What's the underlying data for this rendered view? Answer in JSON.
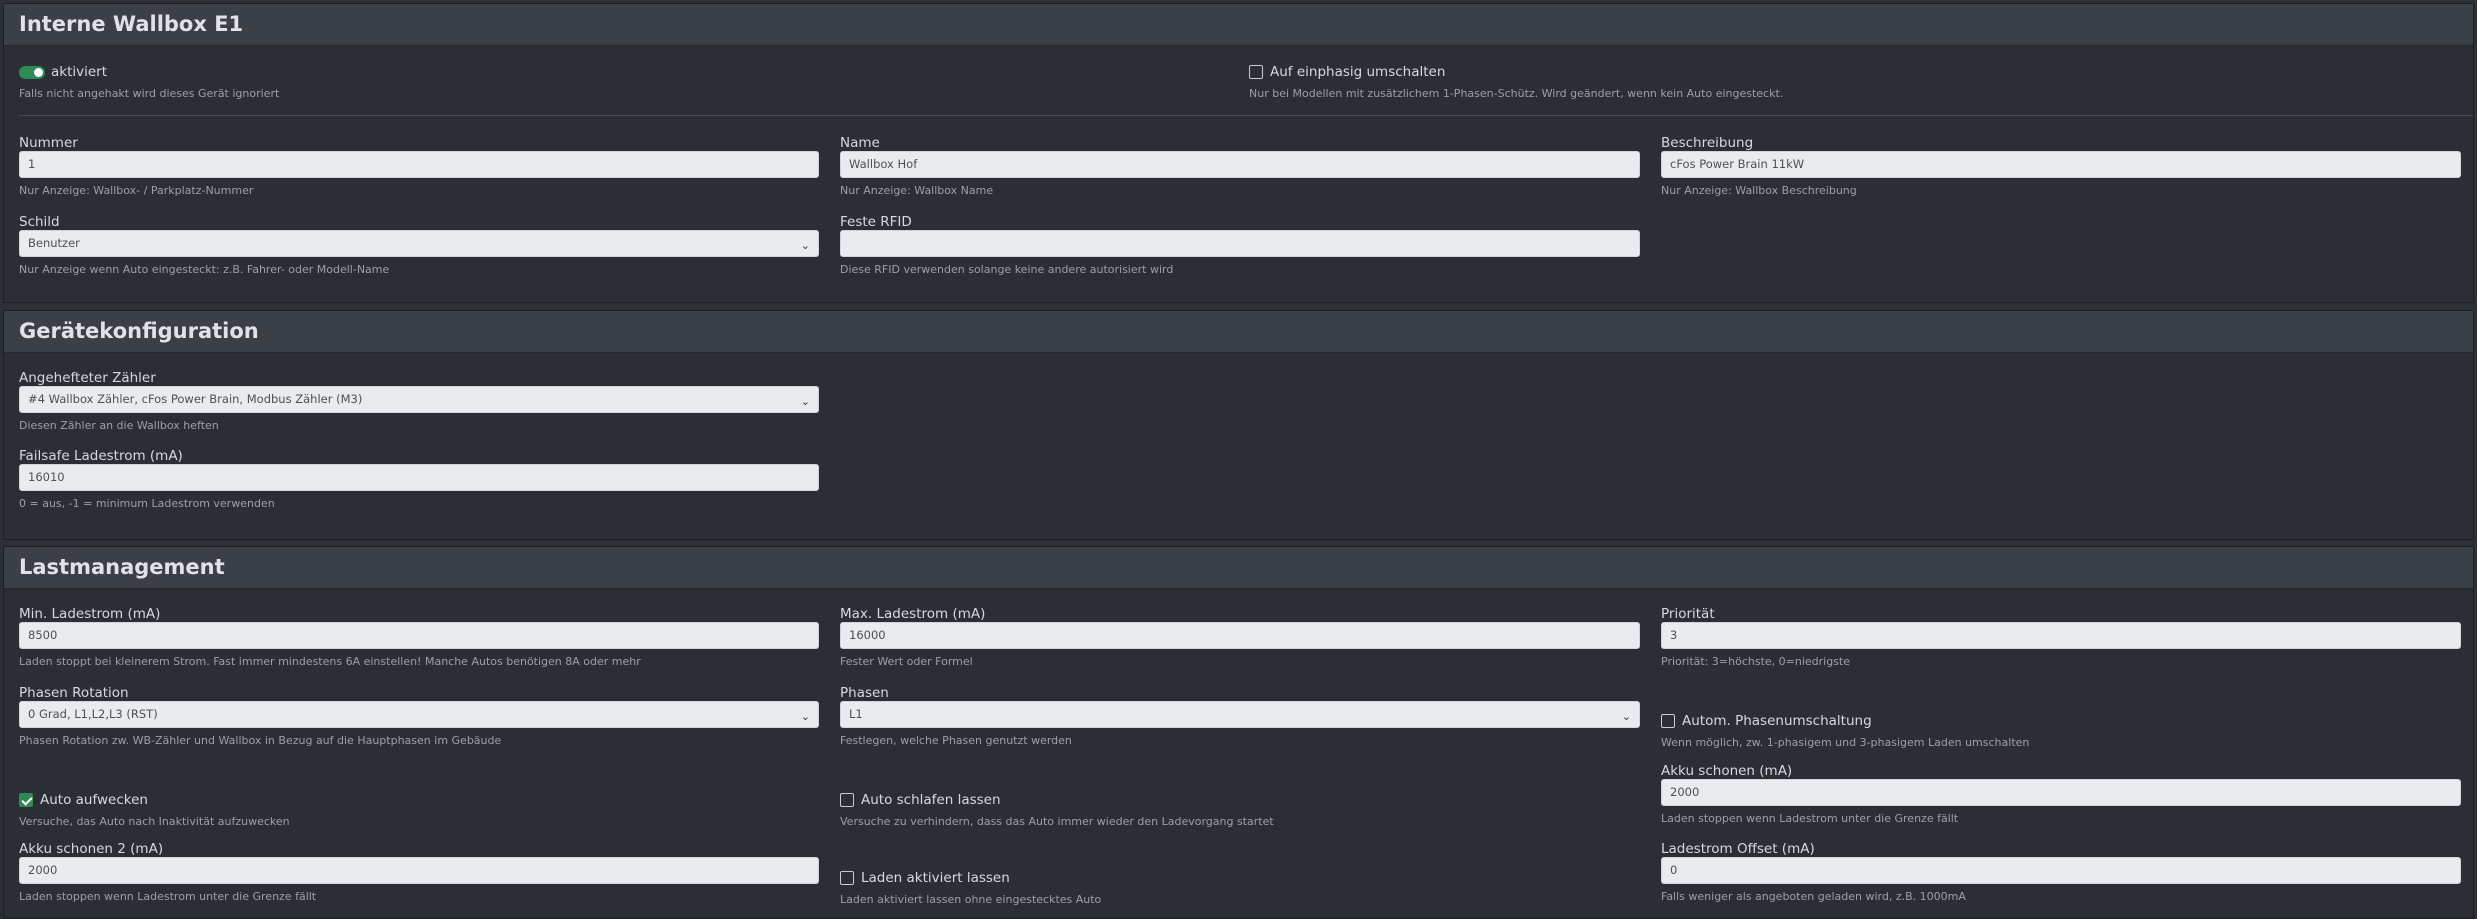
{
  "sections": {
    "wallbox": {
      "title": "Interne Wallbox E1",
      "aktiviert": {
        "label": "aktiviert",
        "help": "Falls nicht angehakt wird dieses Gerät ignoriert",
        "checked": true
      },
      "einphasig": {
        "label": "Auf einphasig umschalten",
        "help": "Nur bei Modellen mit zusätzlichem 1-Phasen-Schütz. Wird geändert, wenn kein Auto eingesteckt.",
        "checked": false
      },
      "nummer": {
        "label": "Nummer",
        "value": "1",
        "help": "Nur Anzeige: Wallbox- / Parkplatz-Nummer"
      },
      "name": {
        "label": "Name",
        "value": "Wallbox Hof",
        "help": "Nur Anzeige: Wallbox Name"
      },
      "beschreibung": {
        "label": "Beschreibung",
        "value": "cFos Power Brain 11kW",
        "help": "Nur Anzeige: Wallbox Beschreibung"
      },
      "schild": {
        "label": "Schild",
        "value": "Benutzer",
        "help": "Nur Anzeige wenn Auto eingesteckt: z.B. Fahrer- oder Modell-Name"
      },
      "rfid": {
        "label": "Feste RFID",
        "value": "",
        "help": "Diese RFID verwenden solange keine andere autorisiert wird"
      }
    },
    "geraet": {
      "title": "Gerätekonfiguration",
      "zaehler": {
        "label": "Angehefteter Zähler",
        "value": "#4 Wallbox Zähler, cFos Power Brain, Modbus Zähler (M3)",
        "help": "Diesen Zähler an die Wallbox heften"
      },
      "failsafe": {
        "label": "Failsafe Ladestrom (mA)",
        "value": "16010",
        "help": "0 = aus, -1 = minimum Ladestrom verwenden"
      }
    },
    "last": {
      "title": "Lastmanagement",
      "min": {
        "label": "Min. Ladestrom (mA)",
        "value": "8500",
        "help": "Laden stoppt bei kleinerem Strom. Fast immer mindestens 6A einstellen! Manche Autos benötigen 8A oder mehr"
      },
      "max": {
        "label": "Max. Ladestrom (mA)",
        "value": "16000",
        "help": "Fester Wert oder Formel"
      },
      "prio": {
        "label": "Priorität",
        "value": "3",
        "help": "Priorität: 3=höchste, 0=niedrigste"
      },
      "rotation": {
        "label": "Phasen Rotation",
        "value": "0 Grad, L1,L2,L3 (RST)",
        "help": "Phasen Rotation zw. WB-Zähler und Wallbox in Bezug auf die Hauptphasen im Gebäude"
      },
      "phasen": {
        "label": "Phasen",
        "value": "L1",
        "help": "Festlegen, welche Phasen genutzt werden"
      },
      "autom": {
        "label": "Autom. Phasenumschaltung",
        "help": "Wenn möglich, zw. 1-phasigem und 3-phasigem Laden umschalten",
        "checked": false
      },
      "akku1": {
        "label": "Akku schonen (mA)",
        "value": "2000",
        "help": "Laden stoppen wenn Ladestrom unter die Grenze fällt"
      },
      "aufwecken": {
        "label": "Auto aufwecken",
        "help": "Versuche, das Auto nach Inaktivität aufzuwecken",
        "checked": true
      },
      "schlafen": {
        "label": "Auto schlafen lassen",
        "help": "Versuche zu verhindern, dass das Auto immer wieder den Ladevorgang startet",
        "checked": false
      },
      "akku2": {
        "label": "Akku schonen 2 (mA)",
        "value": "2000",
        "help": "Laden stoppen wenn Ladestrom unter die Grenze fällt"
      },
      "aktiv": {
        "label": "Laden aktiviert lassen",
        "help": "Laden aktiviert lassen ohne eingestecktes Auto",
        "checked": false
      },
      "offset": {
        "label": "Ladestrom Offset (mA)",
        "value": "0",
        "help": "Falls weniger als angeboten geladen wird, z.B. 1000mA"
      }
    }
  },
  "icons": {
    "select_caret": "chevron-down-icon"
  },
  "colors": {
    "accent": "#2e8b57",
    "header_bg": "#3a3f48",
    "input_bg": "#e9ecef"
  }
}
